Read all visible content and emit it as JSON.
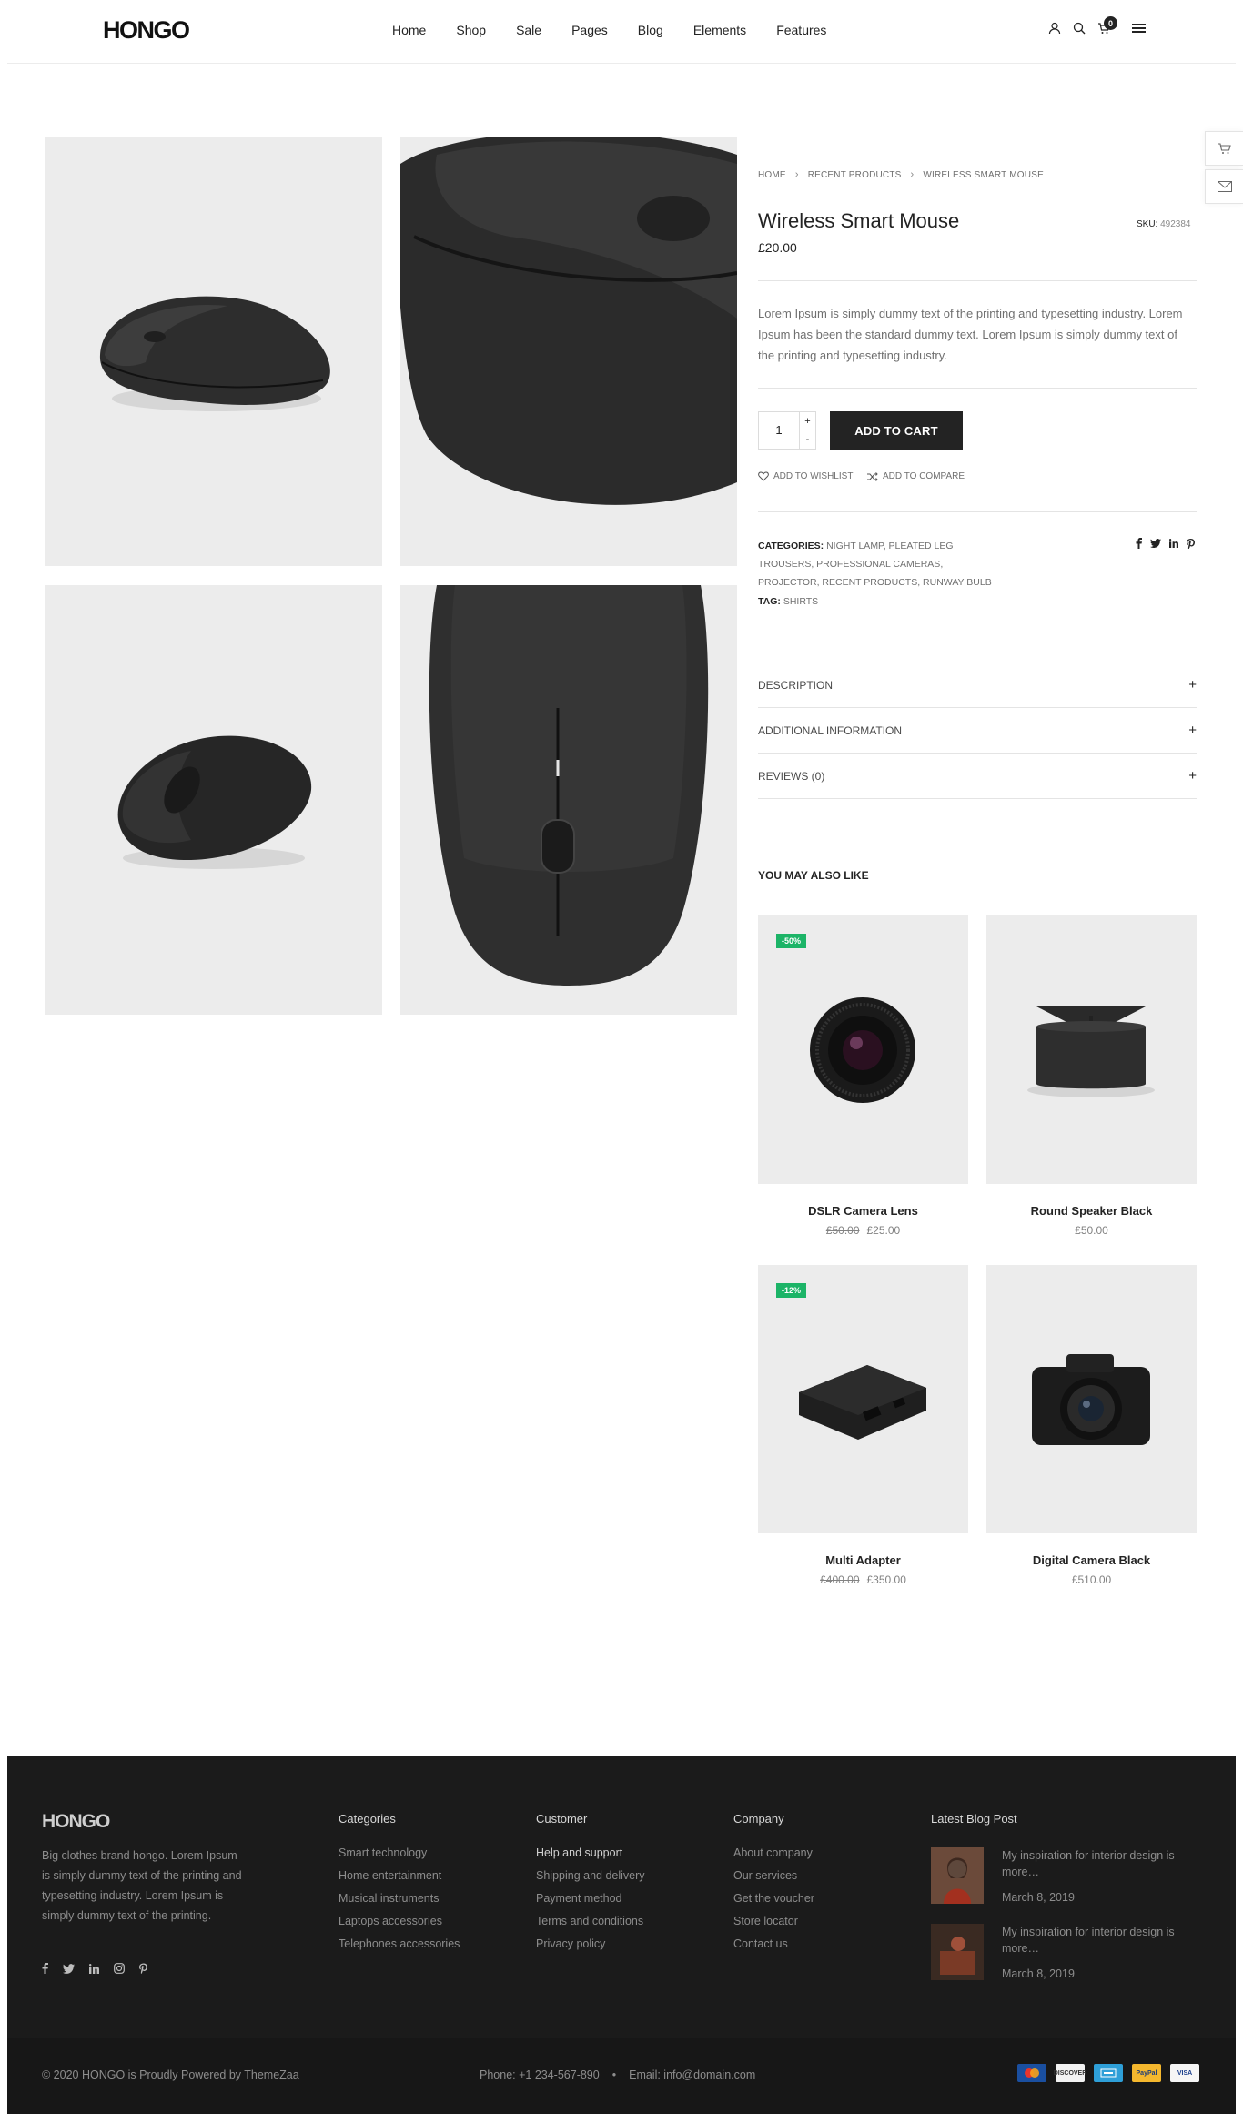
{
  "header": {
    "logo_bold": "HONGO",
    "nav": [
      "Home",
      "Shop",
      "Sale",
      "Pages",
      "Blog",
      "Elements",
      "Features"
    ],
    "cart_count": "0",
    "icons": [
      "user-icon",
      "search-icon",
      "cart-icon",
      "menu-icon"
    ]
  },
  "side_widgets": [
    "cart-icon",
    "mail-icon"
  ],
  "breadcrumb": [
    "HOME",
    "RECENT PRODUCTS",
    "WIRELESS SMART MOUSE"
  ],
  "product": {
    "title": "Wireless Smart Mouse",
    "sku_label": "SKU:",
    "sku": "492384",
    "price": "£20.00",
    "description": "Lorem Ipsum is simply dummy text of the printing and typesetting industry. Lorem Ipsum has been the standard dummy text. Lorem Ipsum is simply dummy text of the printing and typesetting industry.",
    "quantity": "1",
    "qty_plus": "+",
    "qty_minus": "-",
    "add_to_cart": "ADD TO CART",
    "wishlist": "ADD TO WISHLIST",
    "compare": "ADD TO COMPARE",
    "categories_label": "CATEGORIES:",
    "categories": "NIGHT LAMP, PLEATED LEG TROUSERS, PROFESSIONAL CAMERAS, PROJECTOR, RECENT PRODUCTS, RUNWAY BULB",
    "tag_label": "TAG:",
    "tag": "SHIRTS"
  },
  "accordions": [
    {
      "label": "DESCRIPTION",
      "toggle": "+"
    },
    {
      "label": "ADDITIONAL INFORMATION",
      "toggle": "+"
    },
    {
      "label": "REVIEWS (0)",
      "toggle": "+"
    }
  ],
  "related": {
    "heading": "YOU MAY ALSO LIKE",
    "items": [
      {
        "name": "DSLR Camera Lens",
        "old_price": "£50.00",
        "price": "£25.00",
        "badge": "-50%"
      },
      {
        "name": "Round Speaker Black",
        "old_price": "",
        "price": "£50.00",
        "badge": ""
      },
      {
        "name": "Multi Adapter",
        "old_price": "£400.00",
        "price": "£350.00",
        "badge": "-12%"
      },
      {
        "name": "Digital Camera Black",
        "old_price": "",
        "price": "£510.00",
        "badge": ""
      }
    ]
  },
  "footer": {
    "logo_bold": "HONGO",
    "about": "Big clothes brand hongo. Lorem Ipsum is simply dummy text of the printing and typesetting industry. Lorem Ipsum is simply dummy text of the printing.",
    "social": [
      "facebook-icon",
      "twitter-icon",
      "linkedin-icon",
      "instagram-icon",
      "pinterest-icon"
    ],
    "categories": {
      "title": "Categories",
      "items": [
        "Smart technology",
        "Home entertainment",
        "Musical instruments",
        "Laptops accessories",
        "Telephones accessories"
      ]
    },
    "customer": {
      "title": "Customer",
      "items": [
        "Help and support",
        "Shipping and delivery",
        "Payment method",
        "Terms and conditions",
        "Privacy policy"
      ]
    },
    "company": {
      "title": "Company",
      "items": [
        "About company",
        "Our services",
        "Get the voucher",
        "Store locator",
        "Contact us"
      ]
    },
    "blog": {
      "title": "Latest Blog Post",
      "posts": [
        {
          "title": "My inspiration for interior design is more…",
          "date": "March 8, 2019"
        },
        {
          "title": "My inspiration for interior design is more…",
          "date": "March 8, 2019"
        }
      ]
    },
    "copyright": "© 2020 HONGO is Proudly Powered by ThemeZaa",
    "phone": "Phone: +1 234-567-890",
    "bullet": "•",
    "email": "Email: info@domain.com",
    "payments": [
      {
        "name": "mastercard",
        "label": "",
        "color": "#1a4fa0"
      },
      {
        "name": "discover",
        "label": "DISCOVER",
        "color": "#f3f3f3"
      },
      {
        "name": "amex",
        "label": "",
        "color": "#2e9fd8"
      },
      {
        "name": "paypal",
        "label": "PayPal",
        "color": "#f5b82e"
      },
      {
        "name": "visa",
        "label": "VISA",
        "color": "#f6f6f6"
      }
    ]
  },
  "colors": {
    "accent": "#232323",
    "badge": "#1cb467",
    "footer_bg": "#1b1b1b",
    "gallery_bg": "#ececec"
  }
}
